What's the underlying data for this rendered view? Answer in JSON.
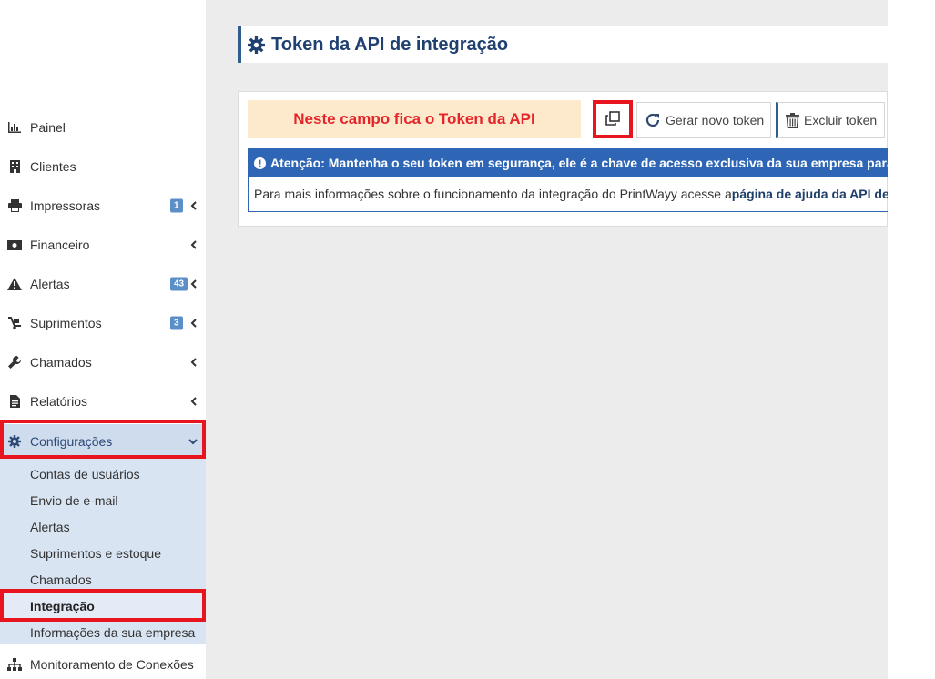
{
  "sidebar": {
    "items": [
      {
        "label": "Painel",
        "icon": "bar-chart-icon"
      },
      {
        "label": "Clientes",
        "icon": "building-icon"
      },
      {
        "label": "Impressoras",
        "icon": "printer-icon",
        "badge": "1"
      },
      {
        "label": "Financeiro",
        "icon": "money-icon"
      },
      {
        "label": "Alertas",
        "icon": "warning-icon",
        "badge": "43"
      },
      {
        "label": "Suprimentos",
        "icon": "dolly-icon",
        "badge": "3"
      },
      {
        "label": "Chamados",
        "icon": "wrench-icon"
      },
      {
        "label": "Relatórios",
        "icon": "file-icon"
      },
      {
        "label": "Configurações",
        "icon": "gear-icon"
      }
    ],
    "submenu": [
      {
        "label": "Contas de usuários"
      },
      {
        "label": "Envio de e-mail"
      },
      {
        "label": "Alertas"
      },
      {
        "label": "Suprimentos e estoque"
      },
      {
        "label": "Chamados"
      },
      {
        "label": "Integração"
      },
      {
        "label": "Informações da sua empresa"
      }
    ],
    "last_item": {
      "label": "Monitoramento de Conexões",
      "icon": "sitemap-icon"
    }
  },
  "page": {
    "title": "Token da API de integração",
    "token_field_annotation": "Neste campo fica o Token da API",
    "regenerate_label": "Gerar novo token",
    "delete_label": "Excluir token",
    "alert_title": "Atenção: Mantenha o seu token em segurança, ele é a chave de acesso exclusiva da sua empresa para re",
    "alert_text": "Para mais informações sobre o funcionamento da integração do PrintWayy acesse a ",
    "alert_link": "página de ajuda da API de i"
  },
  "colors": {
    "accent": "#2e66b5",
    "title": "#1f4070",
    "highlight": "#e8141e",
    "badge": "#5b8fc7",
    "submenu_bg": "#d9e4f2",
    "token_field_bg": "#fde9cc"
  }
}
